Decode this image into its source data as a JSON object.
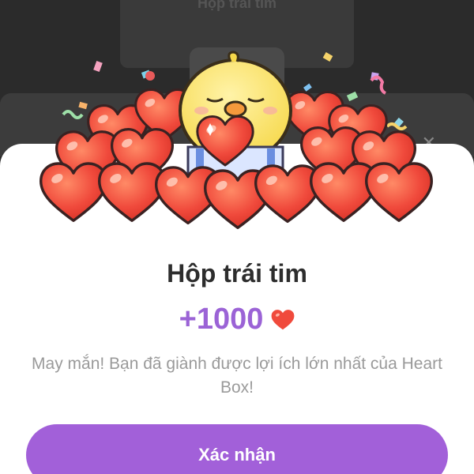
{
  "background": {
    "title": "Hộp trái tim"
  },
  "sheet": {
    "title": "Hộp trái tim",
    "reward": "+1000",
    "reward_icon": "heart-icon",
    "message": "May mắn! Bạn đã giành được lợi ích lớn nhất của Heart Box!",
    "confirm_label": "Xác nhận"
  },
  "colors": {
    "accent": "#a260d9",
    "reward_text": "#9b63d6",
    "heart": "#f04a3c",
    "message_text": "#9a9a9a"
  }
}
